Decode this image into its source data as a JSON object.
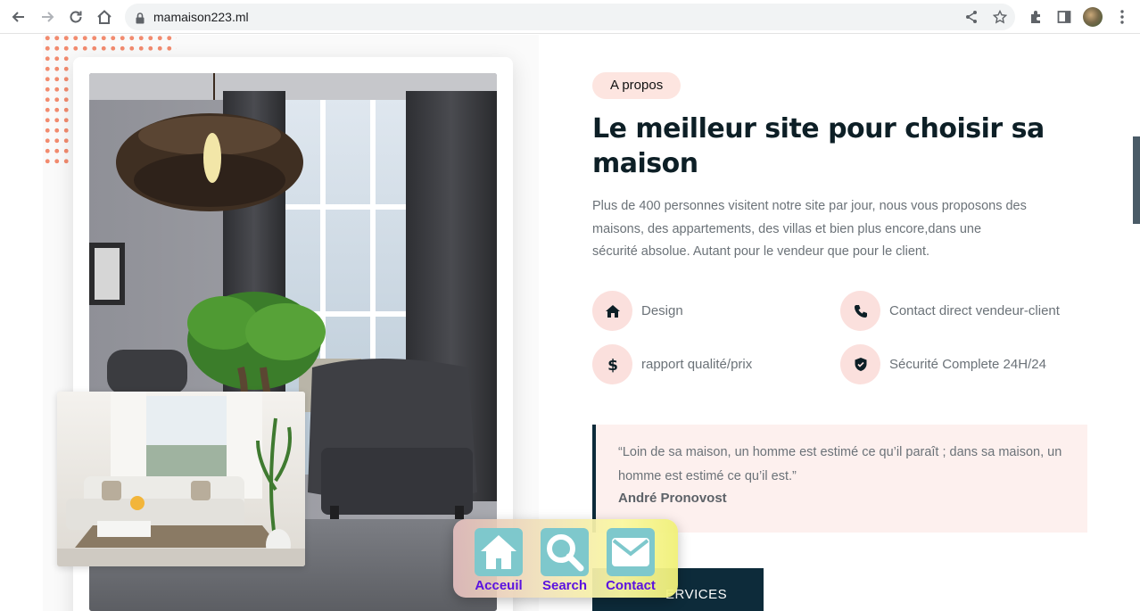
{
  "browser": {
    "url": "mamaison223.ml"
  },
  "about": {
    "badge": "A propos",
    "title": "Le meilleur site pour choisir sa maison",
    "description": "Plus de 400 personnes visitent notre site par jour, nous vous proposons des maisons, des appartements, des villas et bien plus encore,dans une sécurité absolue. Autant pour le vendeur que pour le client.",
    "features": [
      {
        "label": "Design",
        "icon": "home-icon"
      },
      {
        "label": "Contact direct vendeur-client",
        "icon": "phone-icon"
      },
      {
        "label": "rapport qualité/prix",
        "icon": "dollar-icon"
      },
      {
        "label": "Sécurité Complete 24H/24",
        "icon": "shield-icon"
      }
    ],
    "quote": {
      "text": "“Loin de sa maison, un homme est estimé ce qu’il paraît ; dans sa maison, un homme est estimé ce qu’il est.”",
      "author": "André Pronovost"
    },
    "button_label": "ERVICES"
  },
  "dock": {
    "items": [
      {
        "label": "Acceuil",
        "icon": "home-icon"
      },
      {
        "label": "Search",
        "icon": "search-icon"
      },
      {
        "label": "Contact",
        "icon": "mail-icon"
      }
    ]
  },
  "colors": {
    "accent_pink": "#fbe0dd",
    "navy": "#0d2b3a",
    "dock_label": "#5b12e0",
    "dots": "#f28b6f"
  }
}
